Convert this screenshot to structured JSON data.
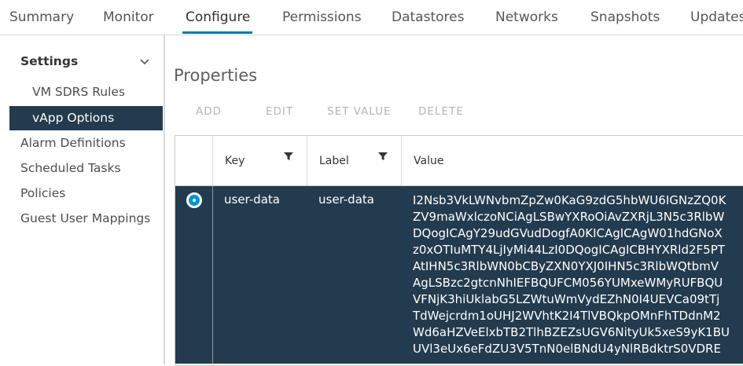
{
  "tabs": [
    "Summary",
    "Monitor",
    "Configure",
    "Permissions",
    "Datastores",
    "Networks",
    "Snapshots",
    "Updates"
  ],
  "active_tab": "Configure",
  "sidebar": {
    "heading": "Settings",
    "items": [
      "VM SDRS Rules",
      "vApp Options",
      "Alarm Definitions",
      "Scheduled Tasks",
      "Policies",
      "Guest User Mappings"
    ],
    "selected": "vApp Options"
  },
  "main": {
    "title": "Properties",
    "actions": [
      "ADD",
      "EDIT",
      "SET VALUE",
      "DELETE"
    ],
    "columns": [
      "Key",
      "Label",
      "Value"
    ],
    "row": {
      "key": "user-data",
      "label": "user-data",
      "value_lines": [
        "I2Nsb3VkLWNvbmZpZw0KaG9zdG5hbWU6IGNzZQ0K",
        "ZV9maWxlczoNCiAgLSBwYXRoOiAvZXRjL3N5c3RlbW",
        "DQogICAgY29udGVudDogfA0KICAgICAgW01hdGNoX",
        "z0xOTIuMTY4LjIyMi44LzI0DQogICAgICBHYXRld2F5PT",
        "AtIHN5c3RlbWN0bCByZXN0YXJ0IHN5c3RlbWQtbmV",
        "AgLSBzc2gtcnNhIEFBQUFCM056YUMxeWMyRUFBQU",
        "VFNjK3hiUklabG5LZWtuWmVydEZhN0I4UEVCa09tTj",
        "TdWejcrdm1oUHJ2WVhtK2I4TlVBQkpOMnFhTDdnM2",
        "Wd6aHZVeElxbTB2TlhBZEZsUGV6NityUk5xeS9yK1BU",
        "UVl3eUx6eFdZU3V5TnN0elBNdU4yNlRBdktrS0VDRE"
      ]
    }
  },
  "colors": {
    "accent": "#0079b8",
    "selected_bg": "#233b4e",
    "radio": "#0094d2"
  }
}
